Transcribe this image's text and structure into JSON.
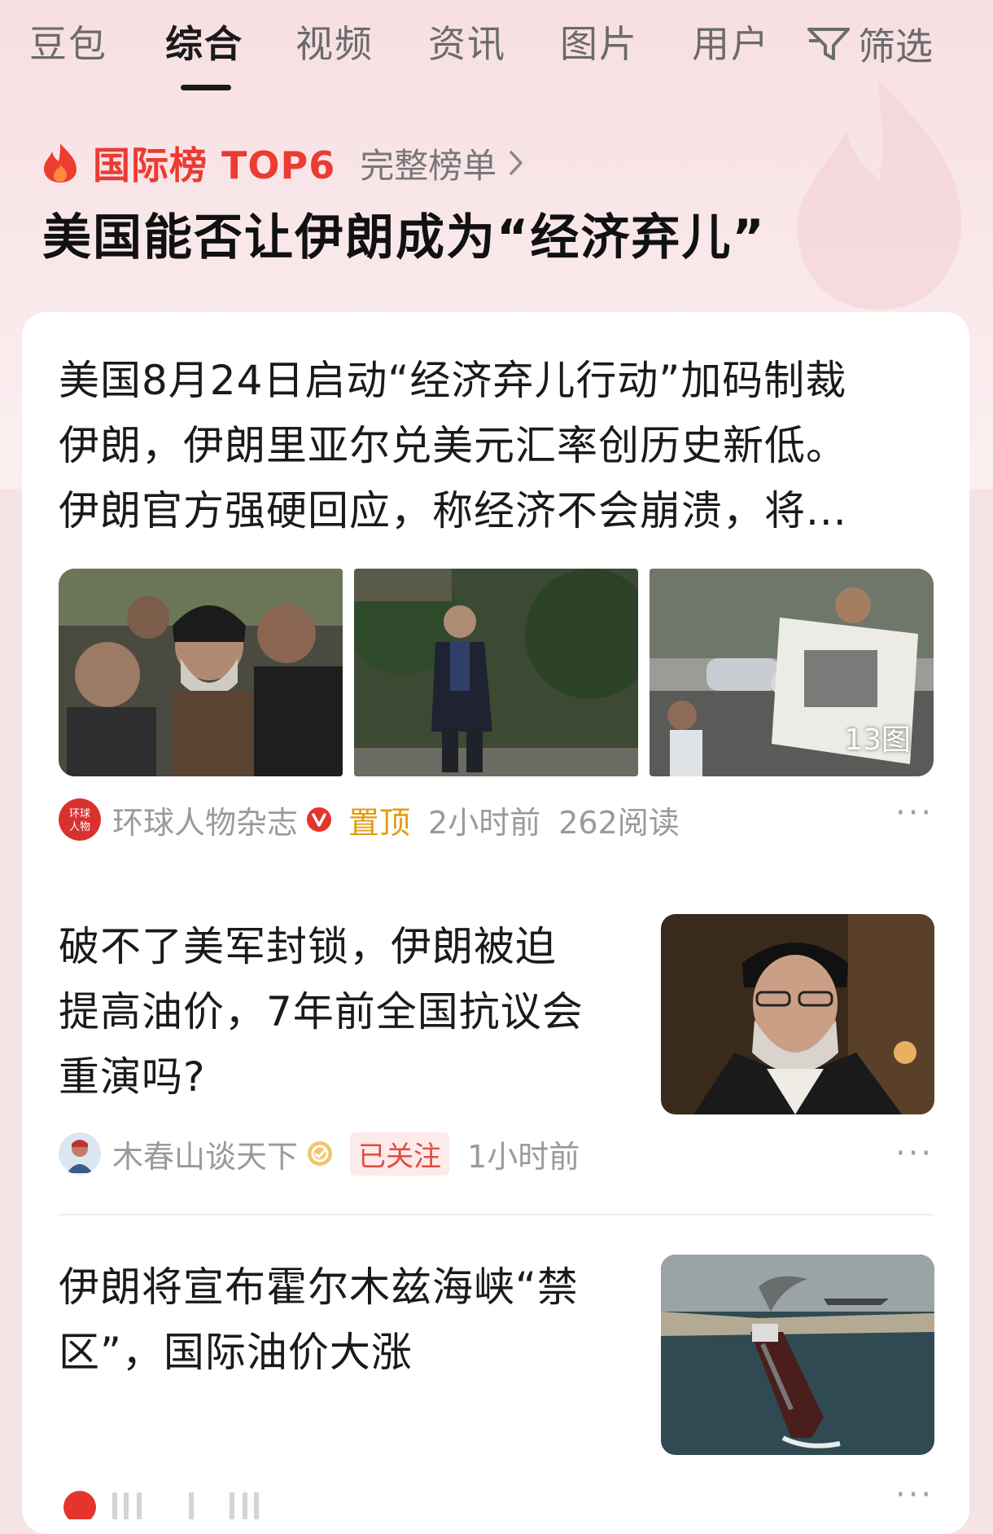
{
  "tabs": [
    {
      "label": "豆包",
      "active": false
    },
    {
      "label": "综合",
      "active": true
    },
    {
      "label": "视频",
      "active": false
    },
    {
      "label": "资讯",
      "active": false
    },
    {
      "label": "图片",
      "active": false
    },
    {
      "label": "用户",
      "active": false
    }
  ],
  "filter_label": "筛选",
  "ranking": {
    "title": "国际榜 TOP6",
    "full_list": "完整榜单",
    "headline": "美国能否让伊朗成为“经济弃儿”"
  },
  "articles": [
    {
      "title_lines": [
        "美国8月24日启动“经济弃儿行动”加码制裁",
        "伊朗，伊朗里亚尔兑美元汇率创历史新低。",
        "伊朗官方强硬回应，称经济不会崩溃，将..."
      ],
      "image_count": "13图",
      "source": "环球人物杂志",
      "avatar_text": "环球人物",
      "pinned_label": "置顶",
      "time": "2小时前",
      "reads": "262阅读",
      "more": "···"
    },
    {
      "title_lines": [
        "破不了美军封锁，伊朗被迫",
        "提高油价，7年前全国抗议会",
        "重演吗?"
      ],
      "source": "木春山谈天下",
      "followed_label": "已关注",
      "time": "1小时前",
      "more": "···"
    },
    {
      "title_lines": [
        "伊朗将宣布霍尔木兹海峡“禁",
        "区”，国际油价大涨"
      ],
      "more": "···"
    }
  ],
  "colors": {
    "accent_red": "#ec3b32",
    "pin_orange": "#e39a12",
    "verified_red": "#e5342c",
    "followed_bg": "#fdeaea"
  }
}
